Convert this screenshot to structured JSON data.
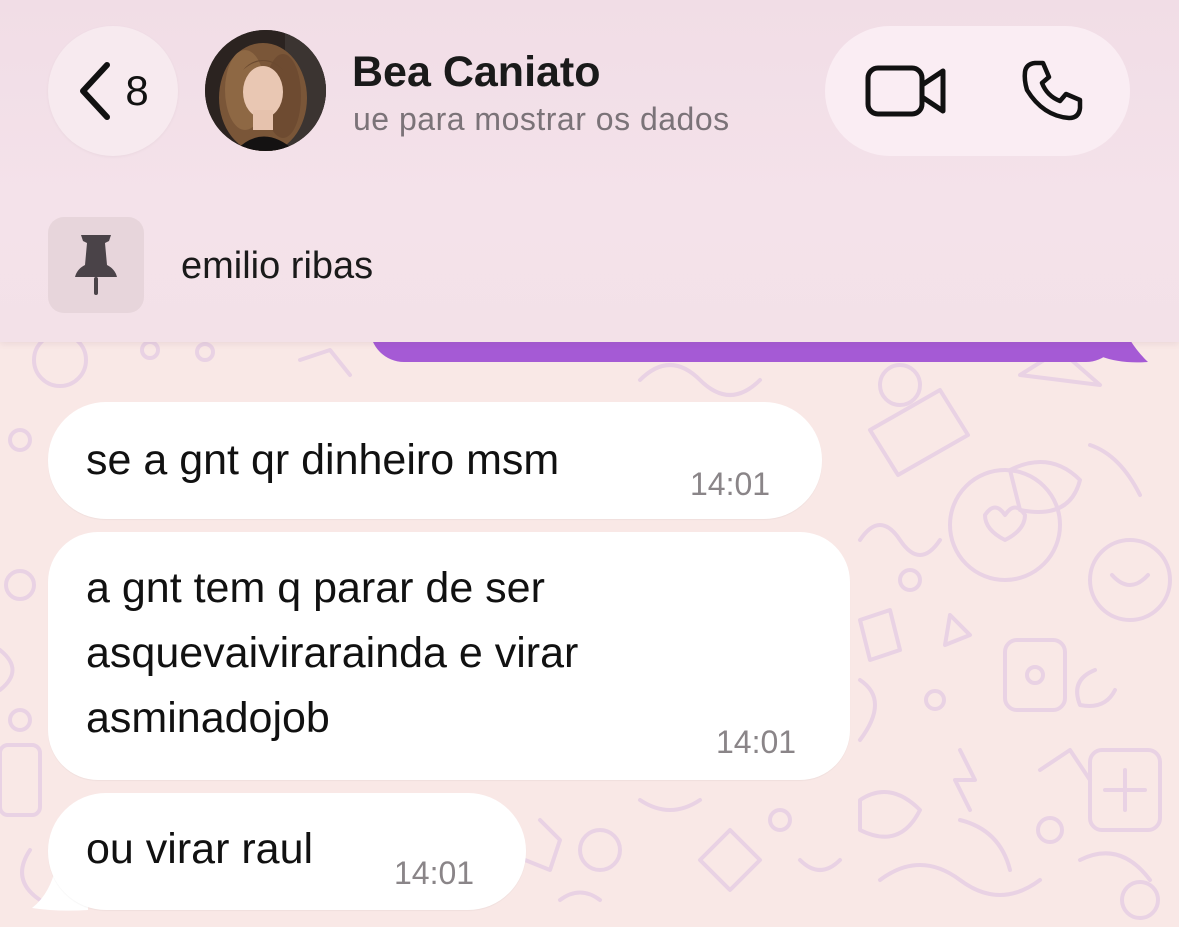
{
  "header": {
    "back_count": "8",
    "contact_name": "Bea Caniato",
    "contact_status": "ue para mostrar os dados",
    "pinned_message": "emilio ribas"
  },
  "messages": [
    {
      "direction": "incoming",
      "lines": [
        "se a gnt qr dinheiro msm"
      ],
      "time": "14:01"
    },
    {
      "direction": "incoming",
      "lines": [
        "a gnt tem q parar de ser",
        "asquevaivirarainda e virar",
        "asminadojob"
      ],
      "time": "14:01"
    },
    {
      "direction": "incoming",
      "lines": [
        "ou virar raul"
      ],
      "time": "14:01"
    }
  ],
  "icons": {
    "back": "chevron-left-icon",
    "video": "video-camera-icon",
    "voice": "phone-icon",
    "pin": "pin-icon"
  },
  "colors": {
    "header_bg": "#f3e1e8",
    "chat_bg": "#f9e8e6",
    "outgoing_bubble": "#a55ad5",
    "incoming_bubble": "#ffffff",
    "timestamp": "#8a8588"
  }
}
